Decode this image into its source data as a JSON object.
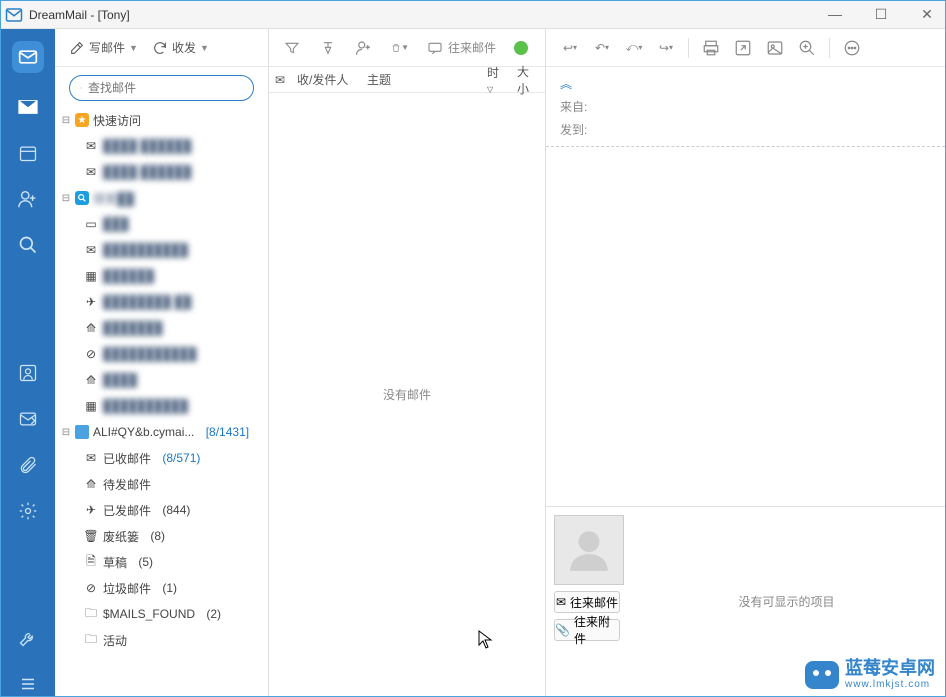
{
  "window": {
    "title": "DreamMail - [Tony]"
  },
  "toolbar": {
    "compose": "写邮件",
    "sync": "收发"
  },
  "search": {
    "placeholder": "查找邮件"
  },
  "tree": {
    "quick": {
      "label": "快速访问",
      "items": [
        {
          "label": "████ ██████"
        },
        {
          "label": "████ ██████"
        }
      ]
    },
    "searchGroup": {
      "label": "搜索██",
      "items": [
        {
          "label": "███"
        },
        {
          "label": "██████████"
        },
        {
          "label": "██████"
        },
        {
          "label": "████████ ██"
        },
        {
          "label": "███████"
        },
        {
          "label": "███████████"
        },
        {
          "label": "████"
        },
        {
          "label": "██████████"
        }
      ]
    },
    "account": {
      "label": "ALI#QY&b.cymai...",
      "count": "[8/1431]",
      "folders": [
        {
          "label": "已收邮件",
          "count": "(8/571)"
        },
        {
          "label": "待发邮件",
          "count": ""
        },
        {
          "label": "已发邮件",
          "count": "(844)"
        },
        {
          "label": "废纸篓",
          "count": "(8)"
        },
        {
          "label": "草稿",
          "count": "(5)"
        },
        {
          "label": "垃圾邮件",
          "count": "(1)"
        },
        {
          "label": "$MAILS_FOUND",
          "count": "(2)"
        },
        {
          "label": "活动",
          "count": ""
        }
      ]
    }
  },
  "listToolbar": {
    "history": "往来邮件"
  },
  "listHeaders": {
    "sender": "收/发件人",
    "subject": "主题",
    "time": "时",
    "size": "大小"
  },
  "list": {
    "empty": "没有邮件"
  },
  "readHeader": {
    "from": "来自:",
    "to": "发到:"
  },
  "contact": {
    "btn1": "往来邮件",
    "btn2": "往来附件",
    "empty": "没有可显示的项目"
  },
  "watermark": {
    "cn": "蓝莓安卓网",
    "en": "www.lmkjst.com"
  }
}
